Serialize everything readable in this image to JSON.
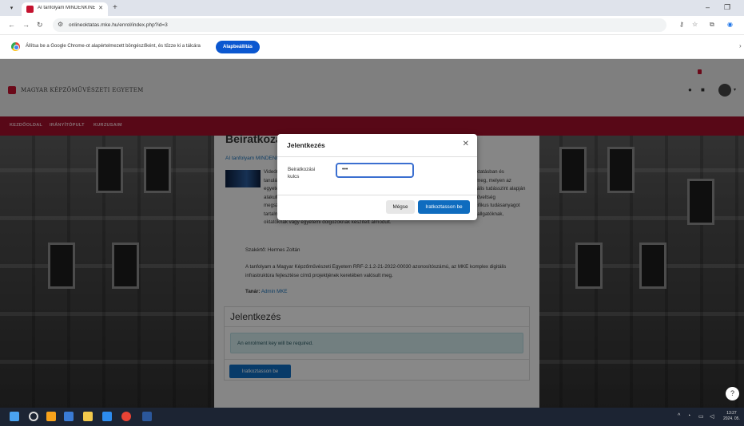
{
  "browser": {
    "tab_title": "AI tanfolyam MINDENKINEK | M",
    "url": "onlineoktatas.mke.hu/enrol/index.php?id=3",
    "infobar_message": "Állítsa be a Google Chrome-ot alapértelmezett böngészőként, és tűzze ki a tálcára",
    "infobar_button": "Alapbeállítás"
  },
  "site": {
    "logo_text": "MAGYAR KÉPZŐMŰVÉSZETI EGYETEM",
    "nav": [
      "KEZDŐOLDAL",
      "IRÁNYÍTÓPULT",
      "KURZUSAIM"
    ]
  },
  "course": {
    "heading": "Beiratkozás",
    "link": "AI tanfolyam MINDENKINEK",
    "description": "Videótanfolyamunk célja olyan AI tudás átadása, melyet a résztvevők a mindennapi munkában, oktatásban és tanulásban praktikusan használni tudnak. A kurzus elkészítését egy összetett szintfelmérő előzte meg, melyen az egyetem hallgatói, oktatói és adminisztratív dolgozói vettek részt, a beérkezett igények és az aktuális tudásszint alapján alakult ki a tanfolyam tartalma. Jelen kurzus a teljes tanfolyam FŐMODULJA, mely általános AI műveltség megszerzését és a gyakorlati alapok elsajátítását szolgálja. Ennek elvégzése után ajánljuk a specifikus tudásanyagot tartalmazó ALMODULOK elvégzését. Mindenki saját intézményi státusa szerint választhatja ki a hallgatóknak, oktatóknak vagy egyetemi dolgozóknak készített almodult.",
    "expert": "Szakértő: Hermes Zoltán",
    "project": "A tanfolyam a Magyar Képzőművészeti Egyetem RRF-2.1.2-21-2022-00030 azonosítószámú, az MKE komplex digitális infrastruktúra fejlesztése című projektjének keretében valósult meg.",
    "teacher_label": "Tanár:",
    "teacher_name": "Admin MKE"
  },
  "enrol_card": {
    "title": "Jelentkezés",
    "alert": "An enrolment key will be required.",
    "button": "Iratkoztasson be"
  },
  "modal": {
    "title": "Jelentkezés",
    "field_label": "Beiratkozási kulcs",
    "field_value": "•••",
    "cancel": "Mégse",
    "submit": "Iratkoztasson be"
  },
  "taskbar": {
    "time": "13:27",
    "date": "2024. 05."
  },
  "colors": {
    "brand": "#a00f2a",
    "primary": "#0f6cbf",
    "chrome_blue": "#0b57d0"
  }
}
